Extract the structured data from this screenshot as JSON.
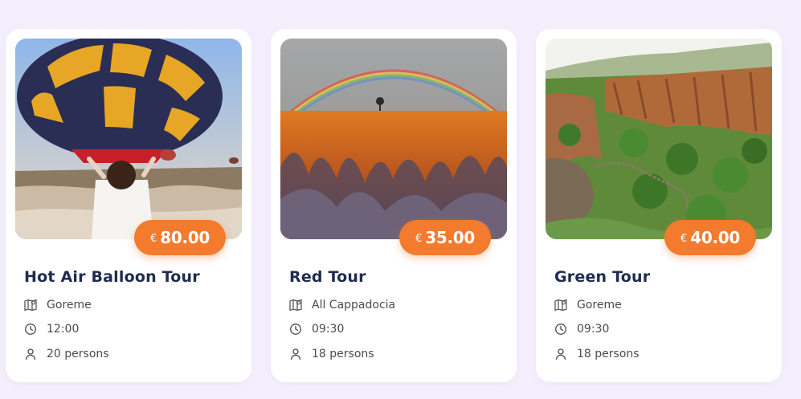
{
  "colors": {
    "accent": "#f47a2d",
    "title": "#1f2b50",
    "background": "#f4effd"
  },
  "tours": [
    {
      "title": "Hot Air Balloon Tour",
      "currency": "€",
      "price": "80.00",
      "location": "Goreme",
      "time": "12:00",
      "persons": "20 persons",
      "image_icon": "hot-air-balloon-photo"
    },
    {
      "title": "Red Tour",
      "currency": "€",
      "price": "35.00",
      "location": "All Cappadocia",
      "time": "09:30",
      "persons": "18 persons",
      "image_icon": "rainbow-valley-photo"
    },
    {
      "title": "Green Tour",
      "currency": "€",
      "price": "40.00",
      "location": "Goreme",
      "time": "09:30",
      "persons": "18 persons",
      "image_icon": "green-canyon-photo"
    }
  ],
  "icons": {
    "location": "map-icon",
    "time": "clock-icon",
    "persons": "person-icon"
  }
}
